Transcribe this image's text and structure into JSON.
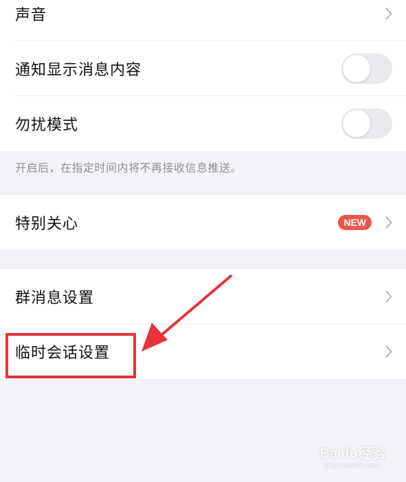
{
  "settings": {
    "sound_label": "声音",
    "notify_preview_label": "通知显示消息内容",
    "notify_preview_on": false,
    "dnd_label": "勿扰模式",
    "dnd_on": false,
    "dnd_hint": "开启后，在指定时间内将不再接收信息推送。",
    "special_care_label": "特别关心",
    "new_badge": "NEW",
    "group_msg_label": "群消息设置",
    "temp_chat_label": "临时会话设置"
  },
  "annotation": {
    "highlight_color": "#e5323b"
  },
  "colors": {
    "background": "#f2f2f7",
    "row_background": "#ffffff",
    "toggle_off": "#e9e9ee",
    "badge": "#e8574a"
  },
  "watermark": {
    "brand": "Baidu经验",
    "url": "jingyan.baidu.com"
  }
}
